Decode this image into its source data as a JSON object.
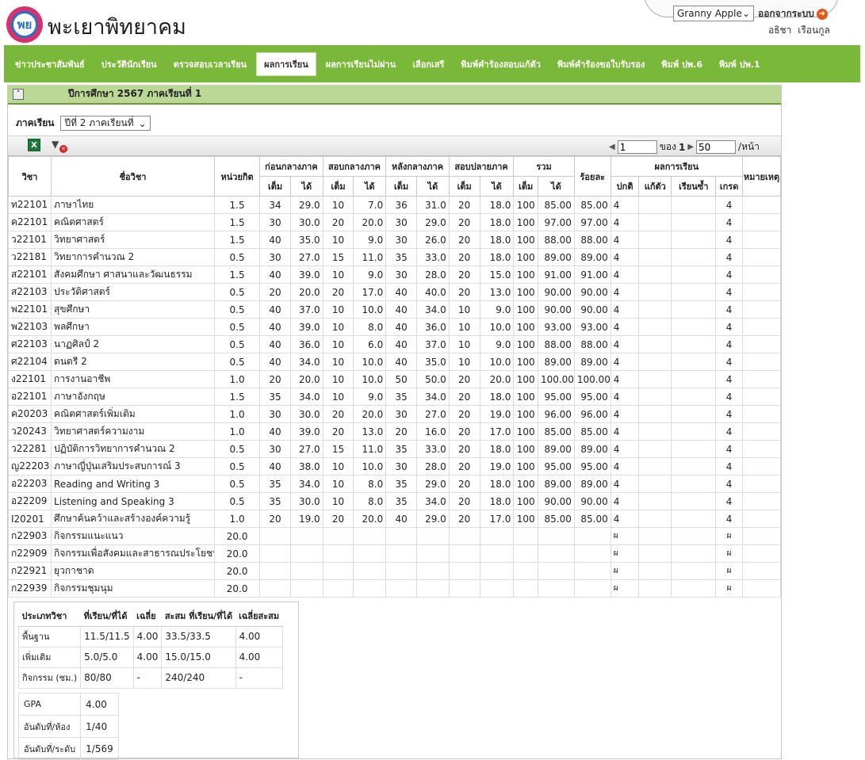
{
  "header": {
    "logo_text": "พย",
    "school_name": "พะเยาพิทยาคม",
    "theme_selected": "Granny Apple",
    "logout_label": "ออกจากระบบ",
    "user_first": "อธิชา",
    "user_last": "เรือนกูล"
  },
  "nav": {
    "items": [
      "ข่าวประชาสัมพันธ์",
      "ประวัตินักเรียน",
      "ตรวจสอบเวลาเรียน",
      "ผลการเรียน",
      "ผลการเรียนไม่ผ่าน",
      "เลือกเสรี",
      "พิมพ์คำร้องสอบแก้ตัว",
      "พิมพ์คำร้องขอใบรับรอง",
      "พิมพ์ ปพ.6",
      "พิมพ์ ปพ.1"
    ],
    "active_index": 3
  },
  "panel": {
    "title": "ปีการศึกษา  2567  ภาคเรียนที่  1",
    "term_label": "ภาคเรียน",
    "term_selected": "ปีที่  2  ภาคเรียนที่"
  },
  "pager": {
    "page": "1",
    "of_label": "ของ",
    "total_pages": "1",
    "per_page": "50",
    "per_page_suffix": "/หน้า"
  },
  "table": {
    "h_code": "วิชา",
    "h_name": "ชื่อวิชา",
    "h_credit": "หน่วยกิต",
    "h_pre_mid": "ก่อนกลางภาค",
    "h_mid": "สอบกลางภาค",
    "h_post_mid": "หลังกลางภาค",
    "h_final": "สอบปลายภาค",
    "h_total": "รวม",
    "h_percent": "ร้อยละ",
    "h_result": "ผลการเรียน",
    "h_remark": "หมายเหตุ",
    "h_full": "เต็ม",
    "h_got": "ได้",
    "h_normal": "ปกติ",
    "h_fix": "แก้ตัว",
    "h_repeat": "เรียนซ้ำ",
    "h_grade": "เกรด",
    "rows": [
      [
        "ท22101",
        "ภาษาไทย",
        "1.5",
        "34",
        "29.0",
        "10",
        "7.0",
        "36",
        "31.0",
        "20",
        "18.0",
        "100",
        "85.00",
        "85.00",
        "4",
        "",
        "",
        "4"
      ],
      [
        "ค22101",
        "คณิตศาสตร์",
        "1.5",
        "30",
        "30.0",
        "20",
        "20.0",
        "30",
        "29.0",
        "20",
        "18.0",
        "100",
        "97.00",
        "97.00",
        "4",
        "",
        "",
        "4"
      ],
      [
        "ว22101",
        "วิทยาศาสตร์",
        "1.5",
        "40",
        "35.0",
        "10",
        "9.0",
        "30",
        "26.0",
        "20",
        "18.0",
        "100",
        "88.00",
        "88.00",
        "4",
        "",
        "",
        "4"
      ],
      [
        "ว22181",
        "วิทยาการคำนวณ  2",
        "0.5",
        "30",
        "27.0",
        "15",
        "11.0",
        "35",
        "33.0",
        "20",
        "18.0",
        "100",
        "89.00",
        "89.00",
        "4",
        "",
        "",
        "4"
      ],
      [
        "ส22101",
        "สังคมศึกษา  ศาสนาและวัฒนธรรม",
        "1.5",
        "40",
        "39.0",
        "10",
        "9.0",
        "30",
        "28.0",
        "20",
        "15.0",
        "100",
        "91.00",
        "91.00",
        "4",
        "",
        "",
        "4"
      ],
      [
        "ส22103",
        "ประวัติศาสตร์",
        "0.5",
        "20",
        "20.0",
        "20",
        "17.0",
        "40",
        "40.0",
        "20",
        "13.0",
        "100",
        "90.00",
        "90.00",
        "4",
        "",
        "",
        "4"
      ],
      [
        "พ22101",
        "สุขศึกษา",
        "0.5",
        "40",
        "37.0",
        "10",
        "10.0",
        "40",
        "34.0",
        "10",
        "9.0",
        "100",
        "90.00",
        "90.00",
        "4",
        "",
        "",
        "4"
      ],
      [
        "พ22103",
        "พลศึกษา",
        "0.5",
        "40",
        "39.0",
        "10",
        "8.0",
        "40",
        "36.0",
        "10",
        "10.0",
        "100",
        "93.00",
        "93.00",
        "4",
        "",
        "",
        "4"
      ],
      [
        "ศ22103",
        "นาฏศิลป์  2",
        "0.5",
        "40",
        "36.0",
        "10",
        "6.0",
        "40",
        "37.0",
        "10",
        "9.0",
        "100",
        "88.00",
        "88.00",
        "4",
        "",
        "",
        "4"
      ],
      [
        "ศ22104",
        "ดนตรี  2",
        "0.5",
        "40",
        "34.0",
        "10",
        "10.0",
        "40",
        "35.0",
        "10",
        "10.0",
        "100",
        "89.00",
        "89.00",
        "4",
        "",
        "",
        "4"
      ],
      [
        "ง22101",
        "การงานอาชีพ",
        "1.0",
        "20",
        "20.0",
        "10",
        "10.0",
        "50",
        "50.0",
        "20",
        "20.0",
        "100",
        "100.00",
        "100.00",
        "4",
        "",
        "",
        "4"
      ],
      [
        "อ22101",
        "ภาษาอังกฤษ",
        "1.5",
        "35",
        "34.0",
        "10",
        "9.0",
        "35",
        "34.0",
        "20",
        "18.0",
        "100",
        "95.00",
        "95.00",
        "4",
        "",
        "",
        "4"
      ],
      [
        "ค20203",
        "คณิตศาสตร์เพิ่มเติม",
        "1.0",
        "30",
        "30.0",
        "20",
        "20.0",
        "30",
        "27.0",
        "20",
        "19.0",
        "100",
        "96.00",
        "96.00",
        "4",
        "",
        "",
        "4"
      ],
      [
        "ว20243",
        "วิทยาศาสตร์ความงาม",
        "1.0",
        "40",
        "39.0",
        "20",
        "13.0",
        "20",
        "16.0",
        "20",
        "17.0",
        "100",
        "85.00",
        "85.00",
        "4",
        "",
        "",
        "4"
      ],
      [
        "ว22281",
        "ปฏิบัติการวิทยาการคำนวณ  2",
        "0.5",
        "30",
        "27.0",
        "15",
        "11.0",
        "35",
        "33.0",
        "20",
        "18.0",
        "100",
        "89.00",
        "89.00",
        "4",
        "",
        "",
        "4"
      ],
      [
        "ญ22203",
        "ภาษาญี่ปุ่นเสริมประสบการณ์  3",
        "0.5",
        "40",
        "38.0",
        "10",
        "10.0",
        "30",
        "28.0",
        "20",
        "19.0",
        "100",
        "95.00",
        "95.00",
        "4",
        "",
        "",
        "4"
      ],
      [
        "อ22203",
        "Reading and Writing 3",
        "0.5",
        "35",
        "34.0",
        "10",
        "8.0",
        "35",
        "29.0",
        "20",
        "18.0",
        "100",
        "89.00",
        "89.00",
        "4",
        "",
        "",
        "4"
      ],
      [
        "อ22209",
        "Listening and Speaking 3",
        "0.5",
        "35",
        "30.0",
        "10",
        "8.0",
        "35",
        "34.0",
        "20",
        "18.0",
        "100",
        "90.00",
        "90.00",
        "4",
        "",
        "",
        "4"
      ],
      [
        "I20201",
        "ศึกษาค้นคว้าและสร้างองค์ความรู้",
        "1.0",
        "20",
        "19.0",
        "20",
        "20.0",
        "40",
        "29.0",
        "20",
        "17.0",
        "100",
        "85.00",
        "85.00",
        "4",
        "",
        "",
        "4"
      ],
      [
        "ก22903",
        "กิจกรรมแนะแนว",
        "20.0",
        "",
        "",
        "",
        "",
        "",
        "",
        "",
        "",
        "",
        "",
        "",
        "ผ",
        "",
        "",
        "ผ"
      ],
      [
        "ก22909",
        "กิจกรรมเพื่อสังคมและสาธารณประโยชน์",
        "20.0",
        "",
        "",
        "",
        "",
        "",
        "",
        "",
        "",
        "",
        "",
        "",
        "ผ",
        "",
        "",
        "ผ"
      ],
      [
        "ก22921",
        "ยุวกาชาด",
        "20.0",
        "",
        "",
        "",
        "",
        "",
        "",
        "",
        "",
        "",
        "",
        "",
        "ผ",
        "",
        "",
        "ผ"
      ],
      [
        "ก22939",
        "กิจกรรมชุมนุม",
        "20.0",
        "",
        "",
        "",
        "",
        "",
        "",
        "",
        "",
        "",
        "",
        "",
        "ผ",
        "",
        "",
        "ผ"
      ]
    ]
  },
  "summary": {
    "h_type": "ประเภทวิชา",
    "h_taken": "ที่เรียน/ที่ได้",
    "h_avg": "เฉลี่ย",
    "h_cum": "สะสม  ที่เรียน/ที่ได้",
    "h_cum_avg": "เฉลี่ยสะสม",
    "rows": [
      [
        "พื้นฐาน",
        "11.5/11.5",
        "4.00",
        "33.5/33.5",
        "4.00"
      ],
      [
        "เพิ่มเติม",
        "5.0/5.0",
        "4.00",
        "15.0/15.0",
        "4.00"
      ],
      [
        "กิจกรรม  (ชม.)",
        "80/80",
        "-",
        "240/240",
        "-"
      ]
    ],
    "gpa_label": "GPA",
    "gpa": "4.00",
    "rank_room_label": "อันดับที่/ห้อง",
    "rank_room": "1/40",
    "rank_level_label": "อันดับที่/ระดับ",
    "rank_level": "1/569"
  }
}
